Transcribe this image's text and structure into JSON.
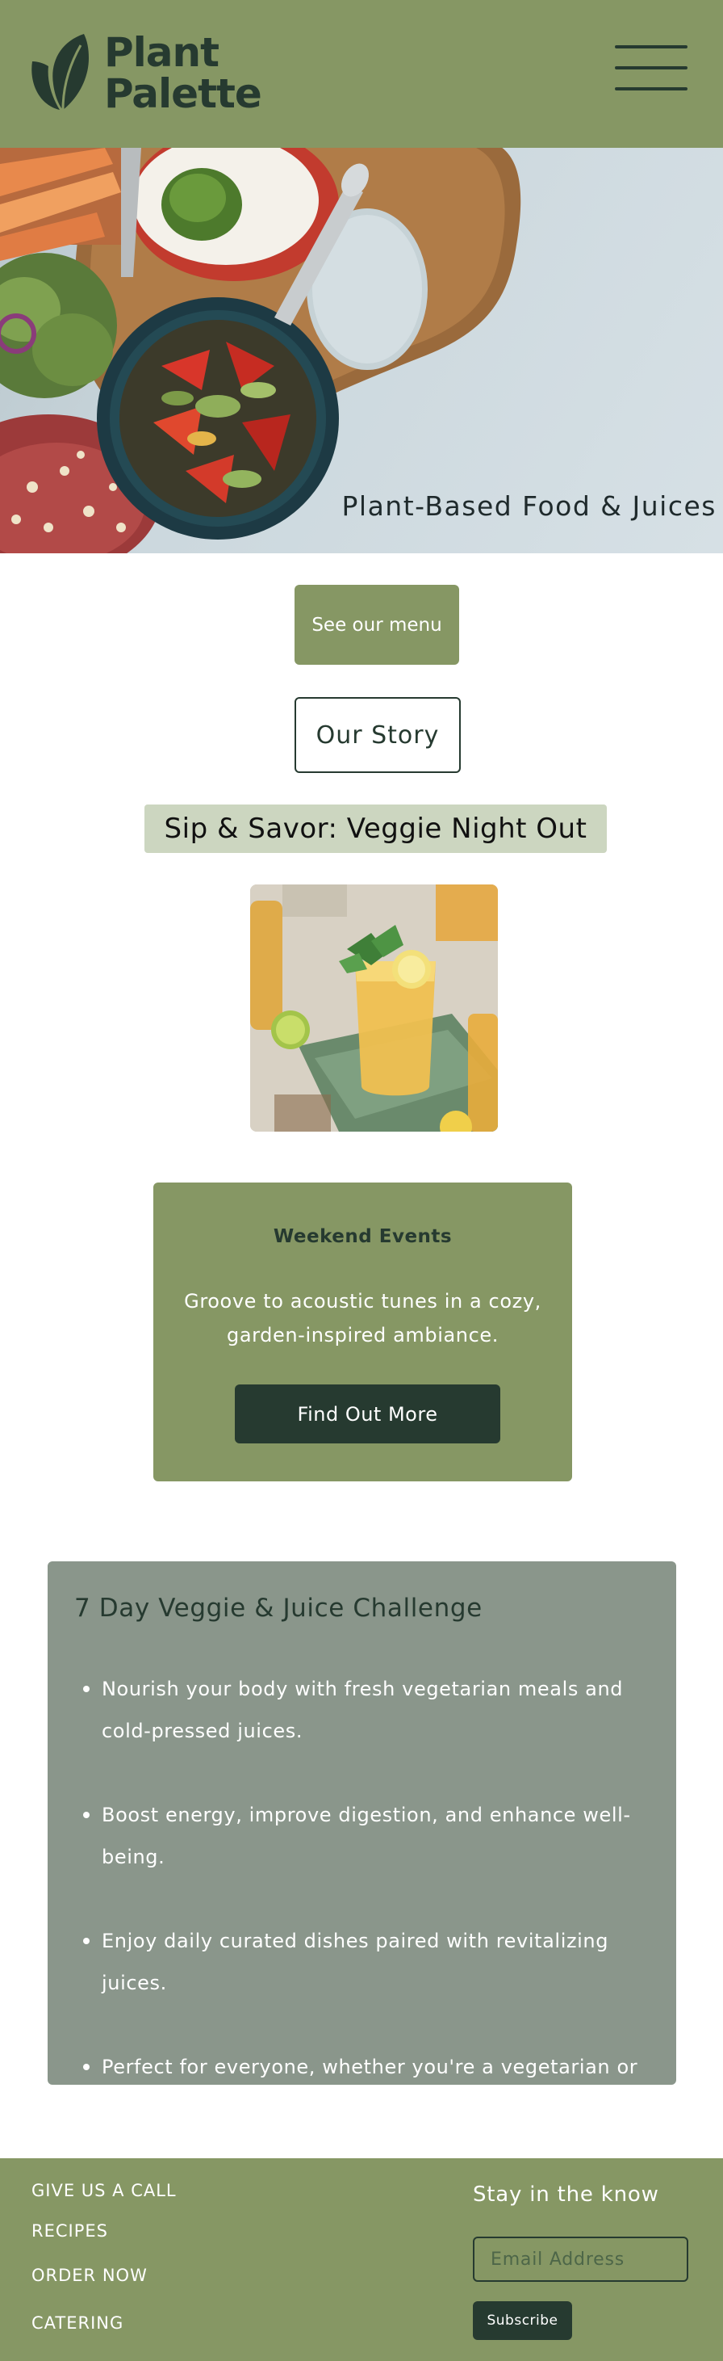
{
  "colors": {
    "brand_green": "#869764",
    "dark_green": "#263a30",
    "muted_green": "#8a968b",
    "pale_green": "#ccd6c0",
    "white": "#ffffff"
  },
  "header": {
    "logo_icon": "leaf-icon",
    "logo_line1": "Plant",
    "logo_line2": "Palette",
    "menu_icon": "hamburger-menu-icon"
  },
  "hero": {
    "caption": "Plant-Based Food & Juices"
  },
  "actions": {
    "see_menu_label": "See our menu",
    "our_story_label": "Our Story"
  },
  "event": {
    "title": "Sip & Savor: Veggie Night Out",
    "card_title": "Weekend Events",
    "card_body": "Groove to acoustic tunes in a cozy, garden-inspired ambiance.",
    "card_button": "Find Out More"
  },
  "challenge": {
    "title": "7 Day Veggie & Juice Challenge",
    "items": [
      "Nourish your body with fresh vegetarian meals and cold-pressed juices.",
      "Boost energy, improve digestion, and enhance well-being.",
      "Enjoy daily curated dishes paired with revitalizing juices.",
      "Perfect for everyone, whether you're a vegetarian or just exploring."
    ]
  },
  "footer": {
    "links": [
      "GIVE US A CALL",
      "RECIPES",
      "ORDER NOW",
      "CATERING"
    ],
    "newsletter_heading": "Stay in the know",
    "email_placeholder": "Email Address",
    "subscribe_label": "Subscribe"
  }
}
